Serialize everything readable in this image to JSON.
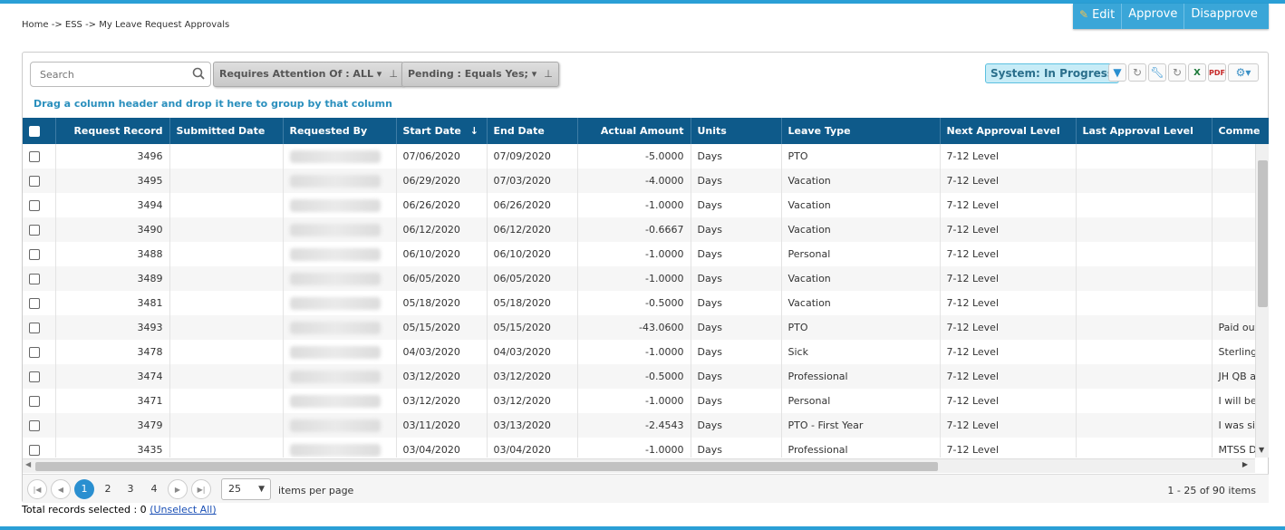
{
  "breadcrumb": "Home -> ESS -> My Leave Request Approvals",
  "actions": {
    "edit": "Edit",
    "approve": "Approve",
    "disapprove": "Disapprove"
  },
  "toolbar": {
    "search_placeholder": "Search",
    "filter_attention": "Requires Attention Of : ALL ▾",
    "filter_pending": "Pending : Equals Yes; ▾",
    "system_status": "System: In Progress",
    "icons": [
      "filter-icon",
      "refresh-icon",
      "wrench-icon",
      "refresh-icon",
      "excel-icon",
      "pdf-icon",
      "gear-icon"
    ]
  },
  "group_hint": "Drag a column header and drop it here to group by that column",
  "columns": [
    "Request Record",
    "Submitted Date",
    "Requested By",
    "Start Date",
    "End Date",
    "Actual Amount",
    "Units",
    "Leave Type",
    "Next Approval Level",
    "Last Approval Level",
    "Comme"
  ],
  "sort_indicator": "↓",
  "rows": [
    {
      "record": "3496",
      "start": "07/06/2020",
      "end": "07/09/2020",
      "amount": "-5.0000",
      "units": "Days",
      "type": "PTO",
      "next": "7-12 Level",
      "comment": ""
    },
    {
      "record": "3495",
      "start": "06/29/2020",
      "end": "07/03/2020",
      "amount": "-4.0000",
      "units": "Days",
      "type": "Vacation",
      "next": "7-12 Level",
      "comment": ""
    },
    {
      "record": "3494",
      "start": "06/26/2020",
      "end": "06/26/2020",
      "amount": "-1.0000",
      "units": "Days",
      "type": "Vacation",
      "next": "7-12 Level",
      "comment": ""
    },
    {
      "record": "3490",
      "start": "06/12/2020",
      "end": "06/12/2020",
      "amount": "-0.6667",
      "units": "Days",
      "type": "Vacation",
      "next": "7-12 Level",
      "comment": ""
    },
    {
      "record": "3488",
      "start": "06/10/2020",
      "end": "06/10/2020",
      "amount": "-1.0000",
      "units": "Days",
      "type": "Personal",
      "next": "7-12 Level",
      "comment": ""
    },
    {
      "record": "3489",
      "start": "06/05/2020",
      "end": "06/05/2020",
      "amount": "-1.0000",
      "units": "Days",
      "type": "Vacation",
      "next": "7-12 Level",
      "comment": ""
    },
    {
      "record": "3481",
      "start": "05/18/2020",
      "end": "05/18/2020",
      "amount": "-0.5000",
      "units": "Days",
      "type": "Vacation",
      "next": "7-12 Level",
      "comment": ""
    },
    {
      "record": "3493",
      "start": "05/15/2020",
      "end": "05/15/2020",
      "amount": "-43.0600",
      "units": "Days",
      "type": "PTO",
      "next": "7-12 Level",
      "comment": "Paid out"
    },
    {
      "record": "3478",
      "start": "04/03/2020",
      "end": "04/03/2020",
      "amount": "-1.0000",
      "units": "Days",
      "type": "Sick",
      "next": "7-12 Level",
      "comment": "Sterling"
    },
    {
      "record": "3474",
      "start": "03/12/2020",
      "end": "03/12/2020",
      "amount": "-0.5000",
      "units": "Days",
      "type": "Professional",
      "next": "7-12 Level",
      "comment": "JH QB a"
    },
    {
      "record": "3471",
      "start": "03/12/2020",
      "end": "03/12/2020",
      "amount": "-1.0000",
      "units": "Days",
      "type": "Personal",
      "next": "7-12 Level",
      "comment": "I will be"
    },
    {
      "record": "3479",
      "start": "03/11/2020",
      "end": "03/13/2020",
      "amount": "-2.4543",
      "units": "Days",
      "type": "PTO - First Year",
      "next": "7-12 Level",
      "comment": "I was si"
    },
    {
      "record": "3435",
      "start": "03/04/2020",
      "end": "03/04/2020",
      "amount": "-1.0000",
      "units": "Days",
      "type": "Professional",
      "next": "7-12 Level",
      "comment": "MTSS D"
    }
  ],
  "pager": {
    "pages": [
      "1",
      "2",
      "3",
      "4"
    ],
    "current": "1",
    "page_size": "25",
    "per_page_label": "items per page",
    "info": "1 - 25 of 90 items"
  },
  "footer": {
    "selected_label": "Total records selected : 0",
    "unselect": "(Unselect All)"
  }
}
